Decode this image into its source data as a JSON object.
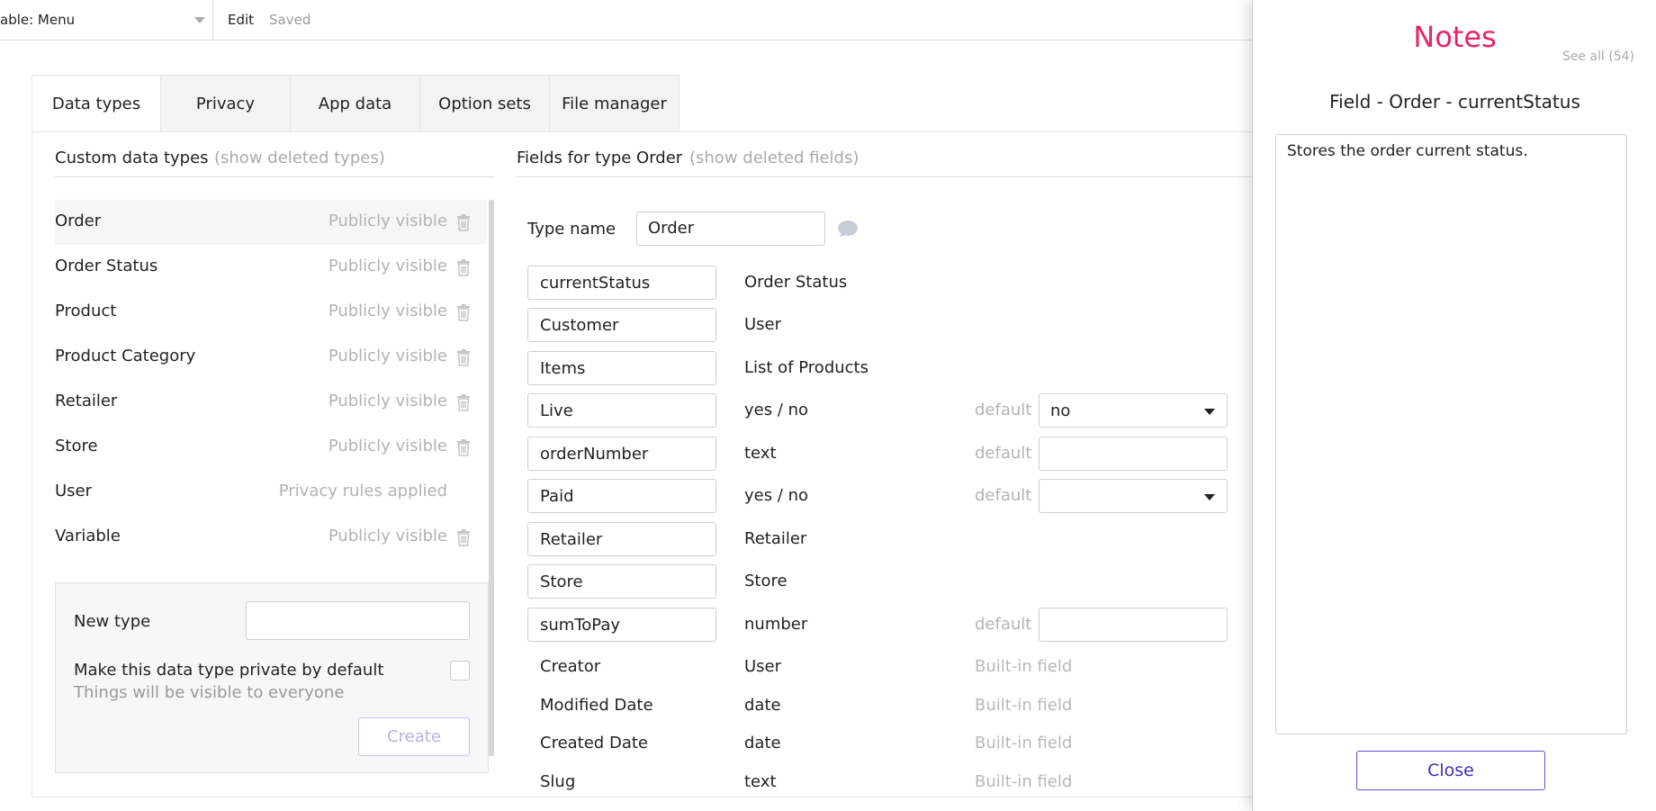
{
  "topbar": {
    "page_select": "able: Menu",
    "edit": "Edit",
    "status": "Saved"
  },
  "tabs": [
    {
      "label": "Data types",
      "active": true
    },
    {
      "label": "Privacy",
      "active": false
    },
    {
      "label": "App data",
      "active": false
    },
    {
      "label": "Option sets",
      "active": false
    },
    {
      "label": "File manager",
      "active": false
    }
  ],
  "left": {
    "heading": "Custom data types",
    "show_deleted": "(show deleted types)",
    "types": [
      {
        "name": "Order",
        "visibility": "Publicly visible",
        "trash": true,
        "selected": true
      },
      {
        "name": "Order Status",
        "visibility": "Publicly visible",
        "trash": true
      },
      {
        "name": "Product",
        "visibility": "Publicly visible",
        "trash": true
      },
      {
        "name": "Product Category",
        "visibility": "Publicly visible",
        "trash": true
      },
      {
        "name": "Retailer",
        "visibility": "Publicly visible",
        "trash": true
      },
      {
        "name": "Store",
        "visibility": "Publicly visible",
        "trash": true
      },
      {
        "name": "User",
        "visibility": "Privacy rules applied",
        "trash": false
      },
      {
        "name": "Variable",
        "visibility": "Publicly visible",
        "trash": true
      }
    ],
    "new_type": {
      "label": "New type",
      "input_value": "",
      "private_label": "Make this data type private by default",
      "private_hint": "Things will be visible to everyone",
      "create_button": "Create"
    }
  },
  "fields": {
    "heading": "Fields for type Order",
    "show_deleted": "(show deleted fields)",
    "type_name_label": "Type name",
    "type_name_value": "Order",
    "rows": [
      {
        "name": "currentStatus",
        "type": "Order Status",
        "editable": true
      },
      {
        "name": "Customer",
        "type": "User",
        "editable": true
      },
      {
        "name": "Items",
        "type": "List of Products",
        "editable": true
      },
      {
        "name": "Live",
        "type": "yes / no",
        "editable": true,
        "default_label": "default",
        "default_value": "no",
        "dropdown": true
      },
      {
        "name": "orderNumber",
        "type": "text",
        "editable": true,
        "default_label": "default",
        "default_value": "",
        "dropdown": false
      },
      {
        "name": "Paid",
        "type": "yes / no",
        "editable": true,
        "default_label": "default",
        "default_value": "",
        "dropdown": true
      },
      {
        "name": "Retailer",
        "type": "Retailer",
        "editable": true
      },
      {
        "name": "Store",
        "type": "Store",
        "editable": true
      },
      {
        "name": "sumToPay",
        "type": "number",
        "editable": true,
        "default_label": "default",
        "default_value": "",
        "dropdown": false
      },
      {
        "name": "Creator",
        "type": "User",
        "editable": false,
        "builtin": "Built-in field"
      },
      {
        "name": "Modified Date",
        "type": "date",
        "editable": false,
        "builtin": "Built-in field"
      },
      {
        "name": "Created Date",
        "type": "date",
        "editable": false,
        "builtin": "Built-in field"
      },
      {
        "name": "Slug",
        "type": "text",
        "editable": false,
        "builtin": "Built-in field"
      }
    ]
  },
  "notes": {
    "title": "Notes",
    "see_all": "See all (54)",
    "subtitle": "Field - Order - currentStatus",
    "text": "Stores the order current status.",
    "close_button": "Close",
    "title_color": "#e8246a"
  }
}
